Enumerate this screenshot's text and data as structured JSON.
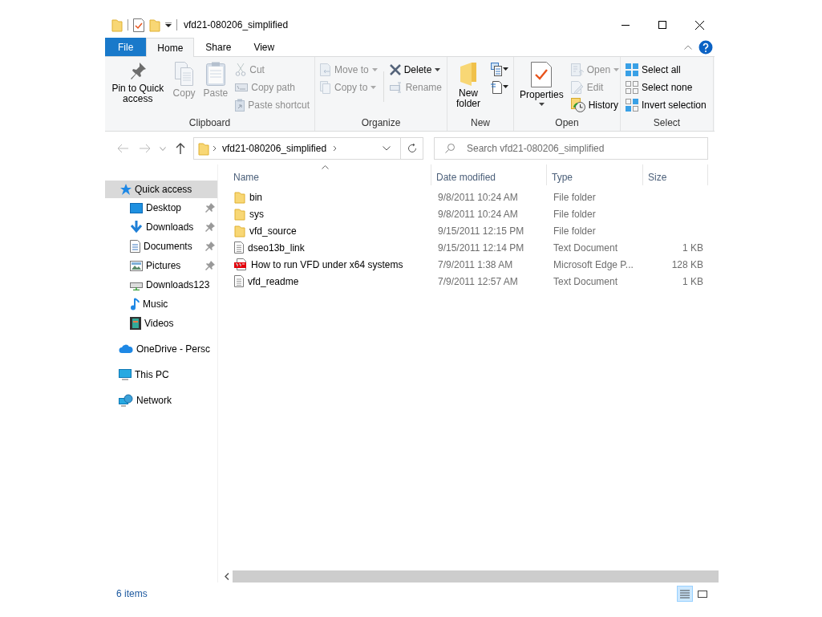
{
  "window": {
    "title": "vfd21-080206_simplified"
  },
  "tabs": [
    {
      "label": "File",
      "kind": "file",
      "selected": false
    },
    {
      "label": "Home",
      "kind": "tab",
      "selected": true
    },
    {
      "label": "Share",
      "kind": "tab",
      "selected": false
    },
    {
      "label": "View",
      "kind": "tab",
      "selected": false
    }
  ],
  "ribbon": [
    {
      "label": "Clipboard",
      "items": [
        {
          "kind": "large",
          "label": "Pin to Quick access",
          "disabled": false,
          "dropdown": false
        },
        {
          "kind": "large",
          "label": "Copy",
          "disabled": true,
          "dropdown": false
        },
        {
          "kind": "large",
          "label": "Paste",
          "disabled": true,
          "dropdown": false
        },
        {
          "kind": "small",
          "label": "Cut",
          "disabled": true,
          "dropdown": false
        },
        {
          "kind": "small",
          "label": "Copy path",
          "disabled": true,
          "dropdown": false
        },
        {
          "kind": "small",
          "label": "Paste shortcut",
          "disabled": true,
          "dropdown": false
        }
      ]
    },
    {
      "label": "Organize",
      "items": [
        {
          "kind": "small",
          "label": "Move to",
          "disabled": true,
          "dropdown": true
        },
        {
          "kind": "small",
          "label": "Copy to",
          "disabled": true,
          "dropdown": true
        },
        {
          "kind": "break"
        },
        {
          "kind": "small",
          "label": "Delete",
          "disabled": false,
          "dropdown": true
        },
        {
          "kind": "small",
          "label": "Rename",
          "disabled": true,
          "dropdown": false
        }
      ]
    },
    {
      "label": "New",
      "items": [
        {
          "kind": "large",
          "label": "New folder",
          "disabled": false,
          "dropdown": false
        },
        {
          "kind": "icon",
          "disabled": false,
          "dropdown": true
        },
        {
          "kind": "icon",
          "disabled": false,
          "dropdown": true
        }
      ]
    },
    {
      "label": "Open",
      "items": [
        {
          "kind": "large",
          "label": "Properties",
          "disabled": false,
          "dropdown": true
        },
        {
          "kind": "small",
          "label": "Open",
          "disabled": true,
          "dropdown": true
        },
        {
          "kind": "small",
          "label": "Edit",
          "disabled": true,
          "dropdown": false
        },
        {
          "kind": "small",
          "label": "History",
          "disabled": false,
          "dropdown": false
        }
      ]
    },
    {
      "label": "Select",
      "items": [
        {
          "kind": "small",
          "label": "Select all",
          "disabled": false,
          "dropdown": false
        },
        {
          "kind": "small",
          "label": "Select none",
          "disabled": false,
          "dropdown": false
        },
        {
          "kind": "small",
          "label": "Invert selection",
          "disabled": false,
          "dropdown": false
        }
      ]
    }
  ],
  "navigation": {
    "back_disabled": true,
    "forward_disabled": true,
    "path": [
      "vfd21-080206_simplified"
    ],
    "search_placeholder": "Search vfd21-080206_simplified"
  },
  "sidebar": {
    "items": [
      {
        "label": "Quick access",
        "selected": true,
        "children": [
          {
            "label": "Desktop",
            "pinned": true,
            "selected": false
          },
          {
            "label": "Downloads",
            "pinned": true,
            "selected": false
          },
          {
            "label": "Documents",
            "pinned": true,
            "selected": false
          },
          {
            "label": "Pictures",
            "pinned": true,
            "selected": false
          },
          {
            "label": "Downloads123",
            "pinned": false,
            "selected": false
          },
          {
            "label": "Music",
            "pinned": false,
            "selected": false
          },
          {
            "label": "Videos",
            "pinned": false,
            "selected": false
          }
        ]
      },
      {
        "label": "OneDrive - Persc",
        "selected": false
      },
      {
        "label": "This PC",
        "selected": false
      },
      {
        "label": "Network",
        "selected": false
      }
    ]
  },
  "table": {
    "columns": [
      {
        "label": "Name",
        "sorted_ascending": true
      },
      {
        "label": "Date modified",
        "sorted_ascending": false
      },
      {
        "label": "Type",
        "sorted_ascending": false
      },
      {
        "label": "Size",
        "sorted_ascending": false
      }
    ],
    "rows": [
      {
        "kind": "folder",
        "name": "bin",
        "date": "9/8/2011 10:24 AM",
        "type": "File folder"
      },
      {
        "kind": "folder",
        "name": "sys",
        "date": "9/8/2011 10:24 AM",
        "type": "File folder"
      },
      {
        "kind": "folder",
        "name": "vfd_source",
        "date": "9/15/2011 12:15 PM",
        "type": "File folder"
      },
      {
        "kind": "text",
        "name": "dseo13b_link",
        "date": "9/15/2011 12:14 PM",
        "type": "Text Document",
        "size": "1 KB"
      },
      {
        "kind": "pdf",
        "name": "How to run VFD under x64 systems",
        "date": "7/9/2011 1:38 AM",
        "type": "Microsoft Edge P...",
        "size": "128 KB"
      },
      {
        "kind": "text",
        "name": "vfd_readme",
        "date": "7/9/2011 12:57 AM",
        "type": "Text Document",
        "size": "1 KB"
      }
    ]
  },
  "status_bar": {
    "text": "6 items",
    "view_buttons": [
      {
        "kind": "details",
        "selected": true
      },
      {
        "kind": "tiles",
        "selected": false
      }
    ]
  }
}
